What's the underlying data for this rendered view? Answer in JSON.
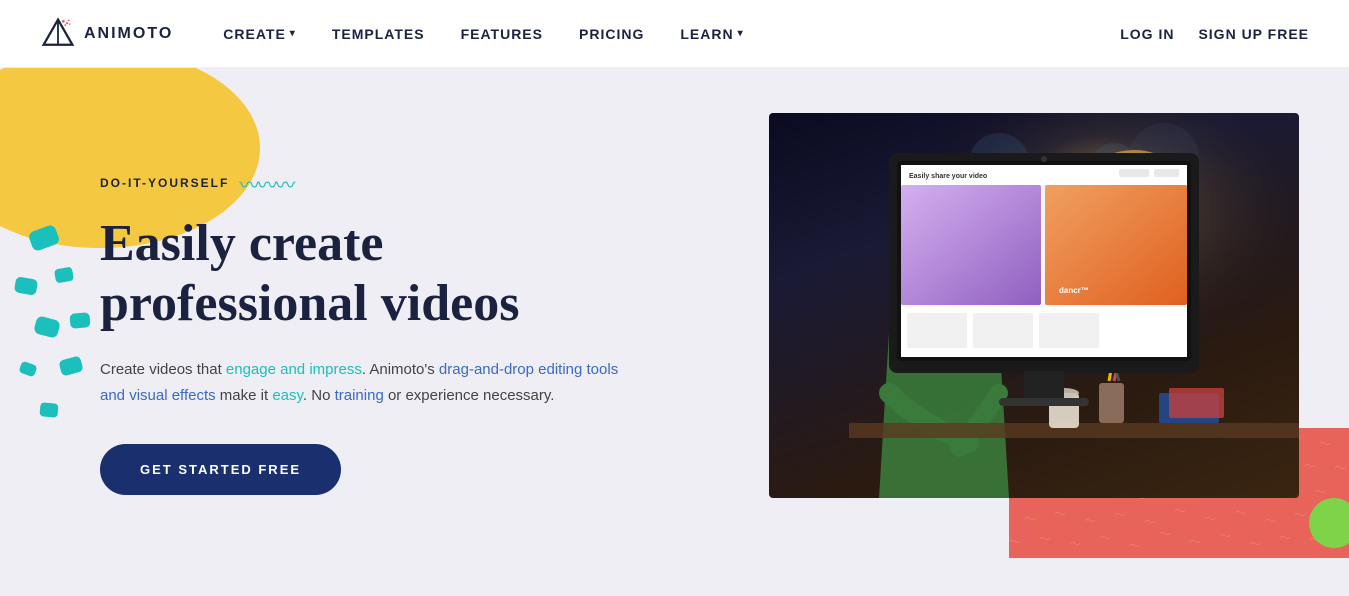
{
  "brand": {
    "logo_text": "ANIMOTO"
  },
  "nav": {
    "create_label": "CREATE",
    "templates_label": "TEMPLATES",
    "features_label": "FEATURES",
    "pricing_label": "PRICING",
    "learn_label": "LEARN",
    "login_label": "LOG IN",
    "signup_label": "SIGN UP FREE"
  },
  "hero": {
    "diy_label": "DO-IT-YOURSELF",
    "title_line1": "Easily create",
    "title_line2": "professional videos",
    "description": "Create videos that engage and impress. Animoto's drag-and-drop editing tools and visual effects make it easy. No training or experience necessary.",
    "cta_label": "GET STARTED FREE"
  },
  "colors": {
    "navy": "#1a2240",
    "teal": "#1bbfbc",
    "yellow": "#f5c842",
    "salmon": "#e8635a",
    "green": "#7ed348",
    "cta_bg": "#1a2f6e"
  }
}
